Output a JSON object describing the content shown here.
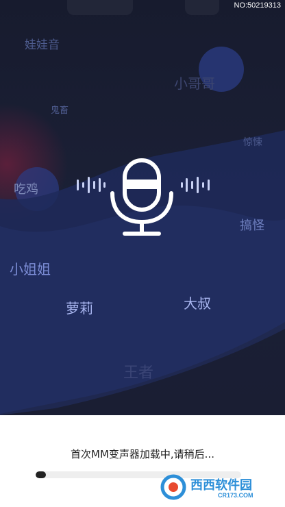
{
  "status_bar": {
    "build_no": "NO:50219313"
  },
  "voice_tags": [
    "娃娃音",
    "小哥哥",
    "鬼畜",
    "惊悚",
    "吃鸡",
    "搞怪",
    "小姐姐",
    "萝莉",
    "大叔",
    "王者"
  ],
  "loading": {
    "message": "首次MM变声器加载中,请稍后...",
    "progress": 0.05
  },
  "watermark": {
    "brand": "西西软件园",
    "domain": "CR173.COM"
  },
  "icons": {
    "center": "microphone-icon",
    "left_wave": "sound-wave-icon",
    "right_wave": "sound-wave-icon"
  },
  "colors": {
    "background": "#1a1e33",
    "accent_blue": "#283a7a",
    "accent_red": "#5a1f3a"
  }
}
